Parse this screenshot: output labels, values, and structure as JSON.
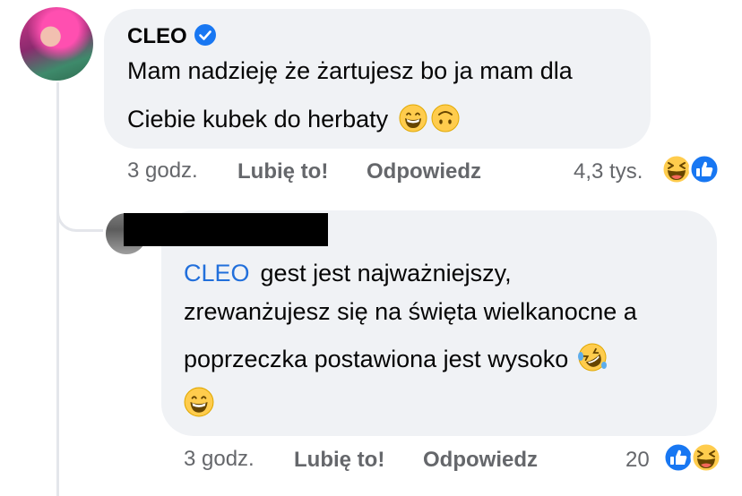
{
  "comment1": {
    "author": "CLEO",
    "line1": "Mam nadzieję że żartujesz bo ja mam dla",
    "line2": "Ciebie kubek do herbaty",
    "time": "3 godz.",
    "like_label": "Lubię to!",
    "reply_label": "Odpowiedz",
    "reaction_count": "4,3 tys.",
    "reactions": [
      "laugh-icon",
      "like-icon"
    ]
  },
  "comment2": {
    "mention": "CLEO",
    "line1": "gest jest najważniejszy,",
    "line2": "zrewanżujesz się na święta wielkanocne a",
    "line3": "poprzeczka postawiona jest wysoko",
    "time": "3 godz.",
    "like_label": "Lubię to!",
    "reply_label": "Odpowiedz",
    "reaction_count": "20",
    "reactions": [
      "like-icon",
      "laugh-icon"
    ]
  },
  "colors": {
    "bubble": "#f0f2f5",
    "mention": "#216fdb",
    "meta": "#65676b",
    "verified": "#1877f2"
  }
}
